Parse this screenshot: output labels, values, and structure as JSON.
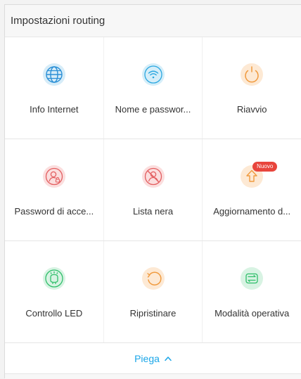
{
  "header": {
    "title": "Impostazioni routing"
  },
  "items": [
    {
      "label": "Info Internet",
      "icon": "globe-icon",
      "color": "#2a8fd6"
    },
    {
      "label": "Nome e passwor...",
      "icon": "wifi-icon",
      "color": "#2aa7e0"
    },
    {
      "label": "Riavvio",
      "icon": "power-icon",
      "color": "#f09a3e"
    },
    {
      "label": "Password di acce...",
      "icon": "user-lock-icon",
      "color": "#e35f61"
    },
    {
      "label": "Lista nera",
      "icon": "user-blocked-icon",
      "color": "#e35f61"
    },
    {
      "label": "Aggiornamento d...",
      "icon": "upgrade-icon",
      "color": "#f09a3e",
      "badge": "Nuovo"
    },
    {
      "label": "Controllo LED",
      "icon": "led-icon",
      "color": "#2fbf6a"
    },
    {
      "label": "Ripristinare",
      "icon": "restore-icon",
      "color": "#f09a3e"
    },
    {
      "label": "Modalità operativa",
      "icon": "mode-switch-icon",
      "color": "#2fbf6a"
    }
  ],
  "footer": {
    "collapse_label": "Piega"
  },
  "colors": {
    "accent": "#1aa6e8",
    "badge": "#e8453c"
  }
}
